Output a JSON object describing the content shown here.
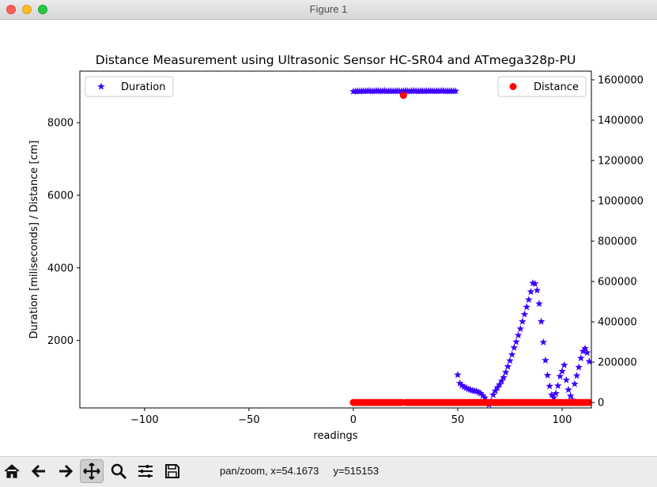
{
  "window": {
    "title": "Figure 1"
  },
  "chart_data": {
    "type": "scatter",
    "title": "Distance Measurement using Ultrasonic Sensor HC-SR04 and ATmega328p-PU",
    "xlabel": "readings",
    "ylabel_left": "Duration [miliseconds] / Distance [cm]",
    "xlim": [
      -131,
      114
    ],
    "ylim_left": [
      140,
      9420
    ],
    "ylim_right": [
      -27000,
      1643000
    ],
    "x_ticks": [
      -100,
      -50,
      0,
      50,
      100
    ],
    "x_tick_labels": [
      "−100",
      "−50",
      "0",
      "50",
      "100"
    ],
    "y_left_ticks": [
      2000,
      4000,
      6000,
      8000
    ],
    "y_left_tick_labels": [
      "2000",
      "4000",
      "6000",
      "8000"
    ],
    "y_right_ticks": [
      0,
      200000,
      400000,
      600000,
      800000,
      1000000,
      1200000,
      1400000,
      1600000
    ],
    "y_right_tick_labels": [
      "0",
      "200000",
      "400000",
      "600000",
      "800000",
      "1000000",
      "1200000",
      "1400000",
      "1600000"
    ],
    "legend_left": {
      "label": "Duration",
      "placement": "upper left"
    },
    "legend_right": {
      "label": "Distance",
      "placement": "upper right"
    },
    "series": [
      {
        "name": "Duration",
        "axis": "left",
        "marker": "star",
        "color": "#3c00ff",
        "x": [
          0,
          1,
          2,
          3,
          4,
          5,
          6,
          7,
          8,
          9,
          10,
          11,
          12,
          13,
          14,
          15,
          16,
          17,
          18,
          19,
          20,
          21,
          22,
          23,
          24,
          25,
          26,
          27,
          28,
          29,
          30,
          31,
          32,
          33,
          34,
          35,
          36,
          37,
          38,
          39,
          40,
          41,
          42,
          43,
          44,
          45,
          46,
          47,
          48,
          49,
          50,
          51,
          52,
          53,
          54,
          55,
          56,
          57,
          58,
          59,
          60,
          61,
          62,
          63,
          64,
          65,
          66,
          67,
          68,
          69,
          70,
          71,
          72,
          73,
          74,
          75,
          76,
          77,
          78,
          79,
          80,
          81,
          82,
          83,
          84,
          85,
          86,
          87,
          88,
          89,
          90,
          91,
          92,
          93,
          94,
          95,
          96,
          97,
          98,
          99,
          100,
          101,
          102,
          103,
          104,
          105,
          106,
          107,
          108,
          109,
          110,
          111,
          112,
          113
        ],
        "y": [
          8860,
          8865,
          8870,
          8862,
          8875,
          8868,
          8870,
          8880,
          8872,
          8866,
          8870,
          8878,
          8874,
          8868,
          8872,
          8880,
          8866,
          8870,
          8875,
          8868,
          8872,
          8876,
          8870,
          8865,
          8872,
          8878,
          8870,
          8866,
          8874,
          8880,
          8870,
          8868,
          8872,
          8876,
          8866,
          8874,
          8870,
          8878,
          8872,
          8868,
          8876,
          8870,
          8874,
          8880,
          8868,
          8872,
          8870,
          8876,
          8866,
          8870,
          1050,
          820,
          760,
          720,
          690,
          660,
          640,
          620,
          610,
          600,
          570,
          540,
          480,
          420,
          300,
          230,
          330,
          500,
          610,
          700,
          780,
          880,
          980,
          1120,
          1280,
          1440,
          1610,
          1800,
          1960,
          2140,
          2320,
          2520,
          2720,
          2920,
          3120,
          3340,
          3580,
          3560,
          3380,
          3010,
          2520,
          1950,
          1450,
          1040,
          740,
          500,
          420,
          540,
          750,
          1010,
          1150,
          1320,
          910,
          640,
          470,
          360,
          800,
          1030,
          1260,
          1510,
          1700,
          1780,
          1660,
          1420
        ]
      },
      {
        "name": "Distance",
        "axis": "right",
        "marker": "circle",
        "color": "#ff0000",
        "x": [
          0,
          1,
          2,
          3,
          4,
          5,
          6,
          7,
          8,
          9,
          10,
          11,
          12,
          13,
          14,
          15,
          16,
          17,
          18,
          19,
          20,
          21,
          22,
          23,
          24,
          25,
          26,
          27,
          28,
          29,
          30,
          31,
          32,
          33,
          34,
          35,
          36,
          37,
          38,
          39,
          40,
          41,
          42,
          43,
          44,
          45,
          46,
          47,
          48,
          49,
          50,
          51,
          52,
          53,
          54,
          55,
          56,
          57,
          58,
          59,
          60,
          61,
          62,
          63,
          64,
          65,
          66,
          67,
          68,
          69,
          70,
          71,
          72,
          73,
          74,
          75,
          76,
          77,
          78,
          79,
          80,
          81,
          82,
          83,
          84,
          85,
          86,
          87,
          88,
          89,
          90,
          91,
          92,
          93,
          94,
          95,
          96,
          97,
          98,
          99,
          100,
          101,
          102,
          103,
          104,
          105,
          106,
          107,
          108,
          109,
          110,
          111,
          112,
          113
        ],
        "y": [
          0,
          0,
          0,
          0,
          0,
          0,
          0,
          0,
          0,
          0,
          0,
          0,
          0,
          0,
          0,
          0,
          0,
          0,
          0,
          0,
          0,
          0,
          0,
          0,
          1523000,
          0,
          0,
          0,
          0,
          0,
          0,
          0,
          0,
          0,
          0,
          0,
          0,
          0,
          0,
          0,
          0,
          0,
          0,
          0,
          0,
          0,
          0,
          0,
          0,
          0,
          0,
          0,
          0,
          0,
          0,
          0,
          0,
          0,
          0,
          0,
          0,
          0,
          0,
          0,
          0,
          0,
          0,
          0,
          0,
          0,
          0,
          0,
          0,
          0,
          0,
          0,
          0,
          0,
          0,
          0,
          0,
          0,
          0,
          0,
          0,
          0,
          0,
          0,
          0,
          0,
          0,
          0,
          0,
          0,
          0,
          0,
          0,
          0,
          0,
          0,
          0,
          0,
          0,
          0,
          0,
          0,
          0,
          0,
          0,
          0,
          0,
          0,
          0,
          0
        ]
      }
    ],
    "grid": false
  },
  "toolbar": {
    "buttons": [
      "home-icon",
      "back-arrow-icon",
      "forward-arrow-icon",
      "pan-move-icon",
      "zoom-magnifier-icon",
      "configure-subplots-icon",
      "save-floppy-icon"
    ],
    "status": "pan/zoom, x=54.1673     y=515153"
  }
}
